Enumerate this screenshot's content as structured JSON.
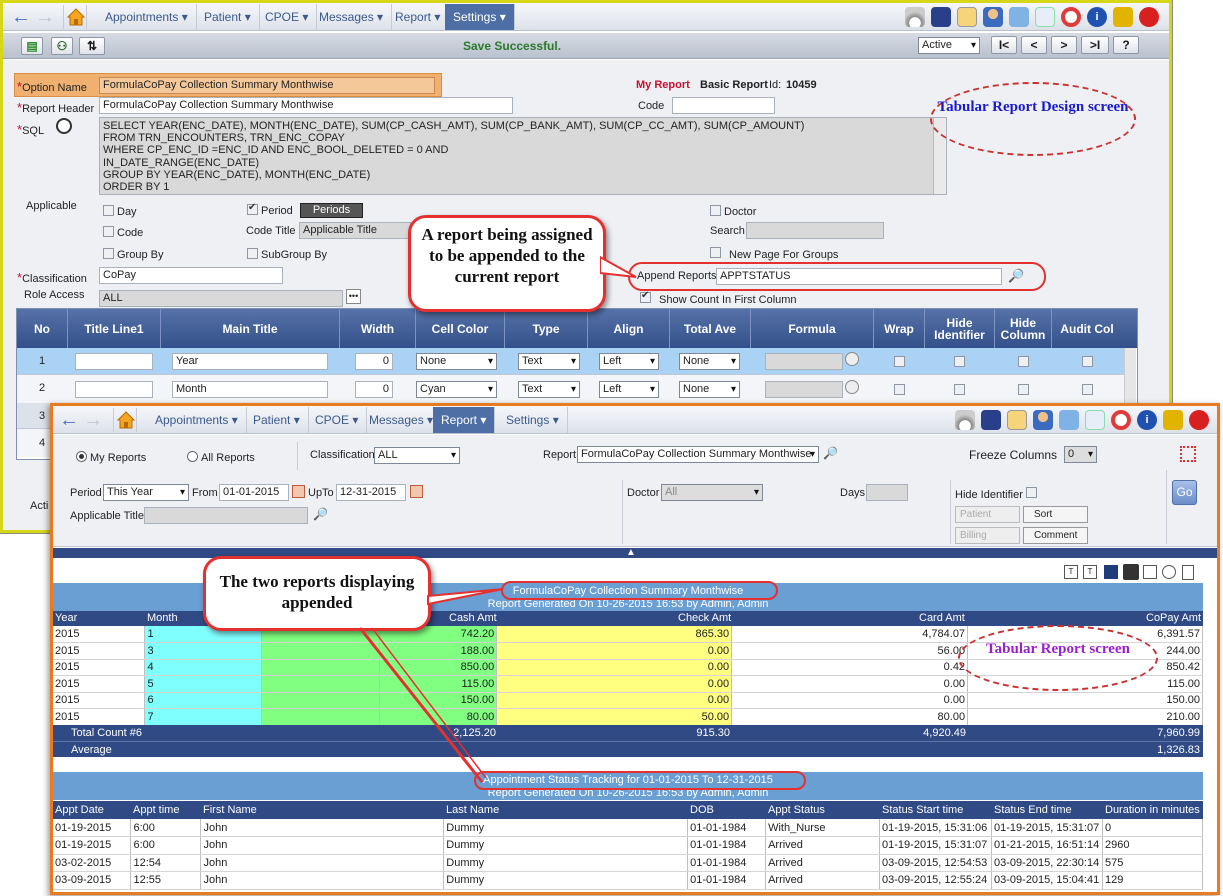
{
  "design": {
    "nav": {
      "menus": [
        "Appointments",
        "Patient",
        "CPOE",
        "Messages",
        "Report",
        "Settings"
      ],
      "active": "Settings"
    },
    "status_message": "Save Successful.",
    "status_select": "Active",
    "pager": [
      "I<",
      "<",
      ">",
      ">I",
      "?"
    ],
    "fields": {
      "option_name_label": "Option Name",
      "option_name": "FormulaCoPay Collection Summary Monthwise",
      "report_header_label": "Report Header",
      "report_header": "FormulaCoPay Collection Summary Monthwise",
      "my_report": "My Report",
      "basic_report": "Basic Report",
      "id_label": "Id:",
      "id_value": "10459",
      "code_label": "Code",
      "code_value": "",
      "sql_label": "SQL",
      "sql_lines": [
        "SELECT YEAR(ENC_DATE), MONTH(ENC_DATE), SUM(CP_CASH_AMT), SUM(CP_BANK_AMT), SUM(CP_CC_AMT), SUM(CP_AMOUNT)",
        "FROM TRN_ENCOUNTERS, TRN_ENC_COPAY",
        "WHERE CP_ENC_ID  =ENC_ID AND ENC_BOOL_DELETED = 0  AND",
        "IN_DATE_RANGE(ENC_DATE)",
        "GROUP BY YEAR(ENC_DATE), MONTH(ENC_DATE)",
        "ORDER BY 1"
      ],
      "applicable": "Applicable",
      "day": "Day",
      "period": "Period",
      "periods_btn": "Periods",
      "doctor": "Doctor",
      "code": "Code",
      "code_title_label": "Code Title",
      "code_title": "Applicable Title",
      "search": "Search",
      "group_by": "Group By",
      "subgroup_by": "SubGroup By",
      "new_page": "New Page For Groups",
      "classification_label": "Classification",
      "classification": "CoPay",
      "append_label": "Append Reports",
      "append_value": "APPTSTATUS",
      "role_label": "Role Access",
      "role_value": "ALL",
      "show_count": "Show Count In First Column",
      "acti": "Acti"
    },
    "grid": {
      "headers": [
        "No",
        "Title Line1",
        "Main Title",
        "Width",
        "Cell Color",
        "Type",
        "Align",
        "Total Ave",
        "Formula",
        "Wrap",
        "Hide Identifier",
        "Hide Column",
        "Audit Col"
      ],
      "rows": [
        {
          "no": "1",
          "main": "Year",
          "width": "0",
          "color": "None",
          "type": "Text",
          "align": "Left",
          "total": "None"
        },
        {
          "no": "2",
          "main": "Month",
          "width": "0",
          "color": "Cyan",
          "type": "Text",
          "align": "Left",
          "total": "None"
        }
      ],
      "extra_nos": [
        "3",
        "4"
      ]
    }
  },
  "screen": {
    "nav": {
      "menus": [
        "Appointments",
        "Patient",
        "CPOE",
        "Messages",
        "Report",
        "Settings"
      ],
      "active": "Report"
    },
    "filters": {
      "my_reports": "My Reports",
      "all_reports": "All Reports",
      "classification_label": "Classification",
      "classification": "ALL",
      "report_label": "Report",
      "report": "FormulaCoPay Collection Summary Monthwise",
      "freeze_label": "Freeze Columns",
      "freeze": "0",
      "period_label": "Period",
      "period": "This Year",
      "from_label": "From",
      "from": "01-01-2015",
      "upto_label": "UpTo",
      "upto": "12-31-2015",
      "applicable_title": "Applicable Title",
      "doctor_label": "Doctor",
      "doctor": "All",
      "days_label": "Days",
      "hide_identifier": "Hide Identifier",
      "go": "Go",
      "buttons": [
        "Patient",
        "Sort",
        "Billing",
        "Comment"
      ]
    },
    "report1": {
      "title": "FormulaCoPay Collection Summary Monthwise",
      "generated": "Report Generated On 10-26-2015 16:53 by Admin, Admin",
      "columns": [
        "Year",
        "Month",
        "Cash Amt",
        "Check Amt",
        "Card Amt",
        "CoPay Amt"
      ],
      "rows": [
        [
          "2015",
          "1",
          "742.20",
          "865.30",
          "4,784.07",
          "6,391.57"
        ],
        [
          "2015",
          "3",
          "188.00",
          "0.00",
          "56.00",
          "244.00"
        ],
        [
          "2015",
          "4",
          "850.00",
          "0.00",
          "0.42",
          "850.42"
        ],
        [
          "2015",
          "5",
          "115.00",
          "0.00",
          "0.00",
          "115.00"
        ],
        [
          "2015",
          "6",
          "150.00",
          "0.00",
          "0.00",
          "150.00"
        ],
        [
          "2015",
          "7",
          "80.00",
          "50.00",
          "80.00",
          "210.00"
        ]
      ],
      "total_label": "Total Count #6",
      "totals": [
        "2,125.20",
        "915.30",
        "4,920.49",
        "7,960.99"
      ],
      "average_label": "Average",
      "average": "1,326.83"
    },
    "report2": {
      "title": "Appointment Status Tracking for 01-01-2015 To 12-31-2015",
      "generated": "Report Generated On 10-26-2015 16:53 by Admin, Admin",
      "columns": [
        "Appt Date",
        "Appt time",
        "First Name",
        "Last Name",
        "DOB",
        "Appt Status",
        "Status Start time",
        "Status End time",
        "Duration in minutes"
      ],
      "rows": [
        [
          "01-19-2015",
          "6:00",
          "John",
          "Dummy",
          "01-01-1984",
          "With_Nurse",
          "01-19-2015, 15:31:06",
          "01-19-2015, 15:31:07",
          "0"
        ],
        [
          "01-19-2015",
          "6:00",
          "John",
          "Dummy",
          "01-01-1984",
          "Arrived",
          "01-19-2015, 15:31:07",
          "01-21-2015, 16:51:14",
          "2960"
        ],
        [
          "03-02-2015",
          "12:54",
          "John",
          "Dummy",
          "01-01-1984",
          "Arrived",
          "03-09-2015, 12:54:53",
          "03-09-2015, 22:30:14",
          "575"
        ],
        [
          "03-09-2015",
          "12:55",
          "John",
          "Dummy",
          "01-01-1984",
          "Arrived",
          "03-09-2015, 12:55:24",
          "03-09-2015, 15:04:41",
          "129"
        ]
      ]
    }
  },
  "annotations": {
    "design_oval": "Tabular Report Design screen",
    "screen_oval": "Tabular Report screen",
    "callout_append": "A report being assigned to be appended to the current report",
    "callout_display": "The two reports displaying appended"
  },
  "colors": {
    "accent": "#4d6fa5",
    "design_border": "#d7d71a",
    "screen_border": "#e87b22",
    "callout": "#e53030",
    "cyan": "#80ffff",
    "green": "#80ff80",
    "yellow": "#ffff80"
  }
}
